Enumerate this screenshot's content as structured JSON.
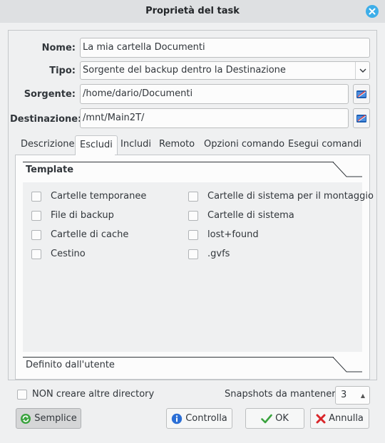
{
  "window": {
    "title": "Proprietà del task",
    "close_icon": "close-icon",
    "accent": "#3daee9"
  },
  "form": {
    "name_label": "Nome:",
    "name_value": "La mia cartella Documenti",
    "type_label": "Tipo:",
    "type_value": "Sorgente del backup dentro la Destinazione",
    "source_label": "Sorgente:",
    "source_value": "/home/dario/Documenti",
    "dest_label": "Destinazione:",
    "dest_value": "/mnt/Main2T/"
  },
  "tabs": [
    {
      "label": "Descrizione",
      "active": false
    },
    {
      "label": "Escludi",
      "active": true
    },
    {
      "label": "Includi",
      "active": false
    },
    {
      "label": "Remoto",
      "active": false
    },
    {
      "label": "Opzioni comando",
      "active": false
    },
    {
      "label": "Esegui comandi",
      "active": false
    }
  ],
  "exclude": {
    "template_title": "Template",
    "templates_left": [
      {
        "label": "Cartelle temporanee",
        "checked": false
      },
      {
        "label": "File di backup",
        "checked": false
      },
      {
        "label": "Cartelle di cache",
        "checked": false
      },
      {
        "label": "Cestino",
        "checked": false
      }
    ],
    "templates_right": [
      {
        "label": "Cartelle di sistema per il montaggio",
        "checked": false
      },
      {
        "label": "Cartelle di sistema",
        "checked": false
      },
      {
        "label": "lost+found",
        "checked": false
      },
      {
        "label": ".gvfs",
        "checked": false
      }
    ],
    "user_defined_title": "Definito dall'utente"
  },
  "options": {
    "no_create_dirs_label": "NON creare altre directory",
    "no_create_dirs_checked": false,
    "snapshots_label": "Snapshots da mantenere:",
    "snapshots_value": "3"
  },
  "buttons": {
    "simple": "Semplice",
    "check": "Controlla",
    "ok": "OK",
    "cancel": "Annulla"
  }
}
